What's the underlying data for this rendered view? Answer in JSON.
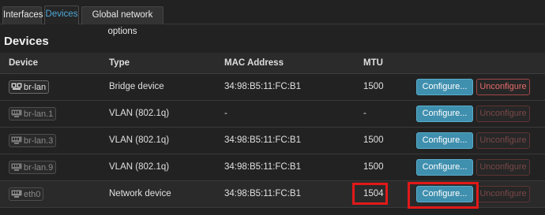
{
  "tabs": [
    {
      "label": "Interfaces"
    },
    {
      "label": "Devices"
    },
    {
      "label": "Global network options"
    }
  ],
  "section_title": "Devices",
  "table": {
    "headers": [
      "Device",
      "Type",
      "MAC Address",
      "MTU"
    ],
    "rows": [
      {
        "device": "br-lan",
        "type": "Bridge device",
        "mac": "34:98:B5:11:FC:B1",
        "mtu": "1500",
        "configure": "Configure...",
        "unconfigure": "Unconfigure"
      },
      {
        "device": "br-lan.1",
        "type": "VLAN (802.1q)",
        "mac": "-",
        "mtu": "-",
        "configure": "Configure...",
        "unconfigure": "Unconfigure"
      },
      {
        "device": "br-lan.3",
        "type": "VLAN (802.1q)",
        "mac": "34:98:B5:11:FC:B1",
        "mtu": "1500",
        "configure": "Configure...",
        "unconfigure": "Unconfigure"
      },
      {
        "device": "br-lan.9",
        "type": "VLAN (802.1q)",
        "mac": "34:98:B5:11:FC:B1",
        "mtu": "1500",
        "configure": "Configure...",
        "unconfigure": "Unconfigure"
      },
      {
        "device": "eth0",
        "type": "Network device",
        "mac": "34:98:B5:11:FC:B1",
        "mtu": "1504",
        "configure": "Configure...",
        "unconfigure": "Unconfigure"
      }
    ]
  },
  "colors": {
    "accent": "#4fa8d8",
    "configure_button": "#3f8fae",
    "unconfigure_border": "#a24747",
    "highlight": "#e11919"
  }
}
